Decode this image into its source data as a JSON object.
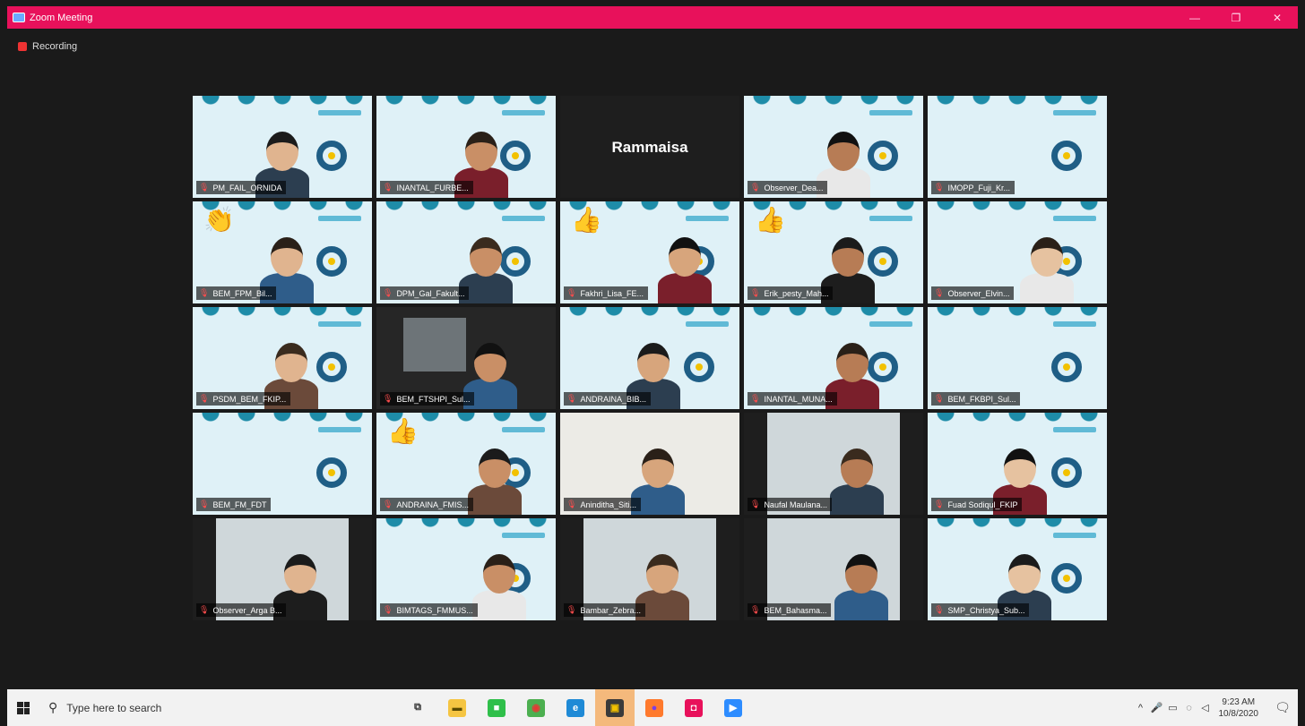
{
  "window": {
    "title": "Zoom Meeting",
    "minimize": "—",
    "maximize": "❐",
    "close": "✕"
  },
  "recording": {
    "label": "Recording"
  },
  "tiles": [
    {
      "name": "PM_FAIL_ORNIDA",
      "type": "video",
      "active": true
    },
    {
      "name": "INANTAL_FURBE...",
      "type": "video"
    },
    {
      "name": "Rammaisa",
      "type": "name-only"
    },
    {
      "name": "Observer_Dea...",
      "type": "video"
    },
    {
      "name": "IMOPP_Fuji_Kr...",
      "type": "video"
    },
    {
      "name": "BEM_FPM_Bil...",
      "type": "video",
      "reaction": "👏"
    },
    {
      "name": "DPM_Gal_Fakult...",
      "type": "video"
    },
    {
      "name": "Fakhri_Lisa_FE...",
      "type": "video",
      "reaction": "👍"
    },
    {
      "name": "Erik_pesty_Mah...",
      "type": "video",
      "reaction": "👍"
    },
    {
      "name": "Observer_Elvin...",
      "type": "video"
    },
    {
      "name": "PSDM_BEM_FKIP...",
      "type": "video"
    },
    {
      "name": "BEM_FTSHPI_Sul...",
      "type": "video-dark"
    },
    {
      "name": "ANDRAINA_BIB...",
      "type": "video"
    },
    {
      "name": "INANTAL_MUNA...",
      "type": "video"
    },
    {
      "name": "BEM_FKBPI_Sul...",
      "type": "video"
    },
    {
      "name": "BEM_FM_FDT",
      "type": "video"
    },
    {
      "name": "ANDRAINA_FMIS...",
      "type": "video",
      "reaction": "👍"
    },
    {
      "name": "Aninditha_Siti...",
      "type": "video-plain"
    },
    {
      "name": "Naufal Maulana...",
      "type": "video-inset"
    },
    {
      "name": "Fuad Sodiqul_FKIP",
      "type": "video"
    },
    {
      "name": "Observer_Arga B...",
      "type": "video-inset"
    },
    {
      "name": "BIMTAGS_FMMUS...",
      "type": "video"
    },
    {
      "name": "Bambar_Zebra...",
      "type": "video-inset"
    },
    {
      "name": "BEM_Bahasma...",
      "type": "video-inset"
    },
    {
      "name": "SMP_Christya_Sub...",
      "type": "video"
    }
  ],
  "taskbar": {
    "search_placeholder": "Type here to search",
    "apps": [
      {
        "icon": "task-view-icon",
        "glyph": "⧉",
        "color": "#f2f2f2",
        "fg": "#333"
      },
      {
        "icon": "file-explorer-icon",
        "glyph": "▬",
        "color": "#f5c542",
        "fg": "#5a4a00"
      },
      {
        "icon": "green-app-icon",
        "glyph": "■",
        "color": "#2fbf4a",
        "fg": "#fff"
      },
      {
        "icon": "chrome-icon",
        "glyph": "◉",
        "color": "#4caf50",
        "fg": "#e53935"
      },
      {
        "icon": "edge-icon",
        "glyph": "e",
        "color": "#1f8ad6",
        "fg": "#fff"
      },
      {
        "icon": "sticky-notes-icon",
        "glyph": "▣",
        "color": "#3a3a3a",
        "fg": "#f2c100",
        "active": true
      },
      {
        "icon": "firefox-icon",
        "glyph": "●",
        "color": "#ff7a2d",
        "fg": "#7b3fe4"
      },
      {
        "icon": "camera-app-icon",
        "glyph": "◘",
        "color": "#e8115b",
        "fg": "#fff"
      },
      {
        "icon": "zoom-icon",
        "glyph": "▶",
        "color": "#2d8cff",
        "fg": "#fff"
      }
    ],
    "tray": {
      "chevron": "^",
      "mic": "🎤",
      "battery": "▭",
      "network": "◌",
      "volume": "◁"
    },
    "time": "9:23 AM",
    "date": "10/8/2020"
  },
  "colors": {
    "titlebar": "#e8115b",
    "meeting_bg": "#1a1a1a",
    "active_outline": "#c6e64a"
  }
}
